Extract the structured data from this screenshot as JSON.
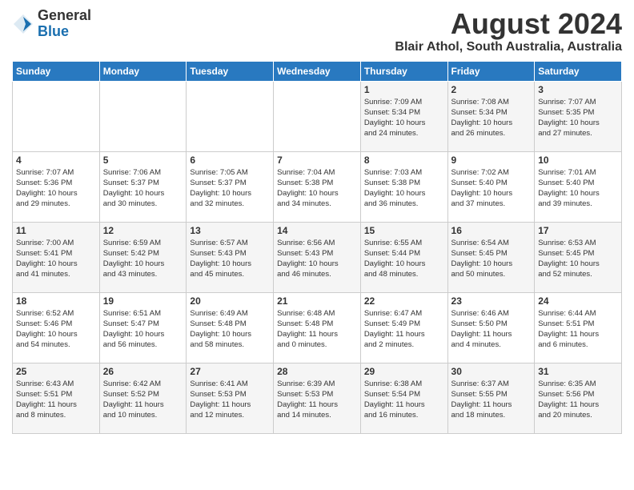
{
  "header": {
    "logo_general": "General",
    "logo_blue": "Blue",
    "month_year": "August 2024",
    "location": "Blair Athol, South Australia, Australia"
  },
  "days_of_week": [
    "Sunday",
    "Monday",
    "Tuesday",
    "Wednesday",
    "Thursday",
    "Friday",
    "Saturday"
  ],
  "weeks": [
    [
      {
        "day": "",
        "content": ""
      },
      {
        "day": "",
        "content": ""
      },
      {
        "day": "",
        "content": ""
      },
      {
        "day": "",
        "content": ""
      },
      {
        "day": "1",
        "content": "Sunrise: 7:09 AM\nSunset: 5:34 PM\nDaylight: 10 hours\nand 24 minutes."
      },
      {
        "day": "2",
        "content": "Sunrise: 7:08 AM\nSunset: 5:34 PM\nDaylight: 10 hours\nand 26 minutes."
      },
      {
        "day": "3",
        "content": "Sunrise: 7:07 AM\nSunset: 5:35 PM\nDaylight: 10 hours\nand 27 minutes."
      }
    ],
    [
      {
        "day": "4",
        "content": "Sunrise: 7:07 AM\nSunset: 5:36 PM\nDaylight: 10 hours\nand 29 minutes."
      },
      {
        "day": "5",
        "content": "Sunrise: 7:06 AM\nSunset: 5:37 PM\nDaylight: 10 hours\nand 30 minutes."
      },
      {
        "day": "6",
        "content": "Sunrise: 7:05 AM\nSunset: 5:37 PM\nDaylight: 10 hours\nand 32 minutes."
      },
      {
        "day": "7",
        "content": "Sunrise: 7:04 AM\nSunset: 5:38 PM\nDaylight: 10 hours\nand 34 minutes."
      },
      {
        "day": "8",
        "content": "Sunrise: 7:03 AM\nSunset: 5:38 PM\nDaylight: 10 hours\nand 36 minutes."
      },
      {
        "day": "9",
        "content": "Sunrise: 7:02 AM\nSunset: 5:40 PM\nDaylight: 10 hours\nand 37 minutes."
      },
      {
        "day": "10",
        "content": "Sunrise: 7:01 AM\nSunset: 5:40 PM\nDaylight: 10 hours\nand 39 minutes."
      }
    ],
    [
      {
        "day": "11",
        "content": "Sunrise: 7:00 AM\nSunset: 5:41 PM\nDaylight: 10 hours\nand 41 minutes."
      },
      {
        "day": "12",
        "content": "Sunrise: 6:59 AM\nSunset: 5:42 PM\nDaylight: 10 hours\nand 43 minutes."
      },
      {
        "day": "13",
        "content": "Sunrise: 6:57 AM\nSunset: 5:43 PM\nDaylight: 10 hours\nand 45 minutes."
      },
      {
        "day": "14",
        "content": "Sunrise: 6:56 AM\nSunset: 5:43 PM\nDaylight: 10 hours\nand 46 minutes."
      },
      {
        "day": "15",
        "content": "Sunrise: 6:55 AM\nSunset: 5:44 PM\nDaylight: 10 hours\nand 48 minutes."
      },
      {
        "day": "16",
        "content": "Sunrise: 6:54 AM\nSunset: 5:45 PM\nDaylight: 10 hours\nand 50 minutes."
      },
      {
        "day": "17",
        "content": "Sunrise: 6:53 AM\nSunset: 5:45 PM\nDaylight: 10 hours\nand 52 minutes."
      }
    ],
    [
      {
        "day": "18",
        "content": "Sunrise: 6:52 AM\nSunset: 5:46 PM\nDaylight: 10 hours\nand 54 minutes."
      },
      {
        "day": "19",
        "content": "Sunrise: 6:51 AM\nSunset: 5:47 PM\nDaylight: 10 hours\nand 56 minutes."
      },
      {
        "day": "20",
        "content": "Sunrise: 6:49 AM\nSunset: 5:48 PM\nDaylight: 10 hours\nand 58 minutes."
      },
      {
        "day": "21",
        "content": "Sunrise: 6:48 AM\nSunset: 5:48 PM\nDaylight: 11 hours\nand 0 minutes."
      },
      {
        "day": "22",
        "content": "Sunrise: 6:47 AM\nSunset: 5:49 PM\nDaylight: 11 hours\nand 2 minutes."
      },
      {
        "day": "23",
        "content": "Sunrise: 6:46 AM\nSunset: 5:50 PM\nDaylight: 11 hours\nand 4 minutes."
      },
      {
        "day": "24",
        "content": "Sunrise: 6:44 AM\nSunset: 5:51 PM\nDaylight: 11 hours\nand 6 minutes."
      }
    ],
    [
      {
        "day": "25",
        "content": "Sunrise: 6:43 AM\nSunset: 5:51 PM\nDaylight: 11 hours\nand 8 minutes."
      },
      {
        "day": "26",
        "content": "Sunrise: 6:42 AM\nSunset: 5:52 PM\nDaylight: 11 hours\nand 10 minutes."
      },
      {
        "day": "27",
        "content": "Sunrise: 6:41 AM\nSunset: 5:53 PM\nDaylight: 11 hours\nand 12 minutes."
      },
      {
        "day": "28",
        "content": "Sunrise: 6:39 AM\nSunset: 5:53 PM\nDaylight: 11 hours\nand 14 minutes."
      },
      {
        "day": "29",
        "content": "Sunrise: 6:38 AM\nSunset: 5:54 PM\nDaylight: 11 hours\nand 16 minutes."
      },
      {
        "day": "30",
        "content": "Sunrise: 6:37 AM\nSunset: 5:55 PM\nDaylight: 11 hours\nand 18 minutes."
      },
      {
        "day": "31",
        "content": "Sunrise: 6:35 AM\nSunset: 5:56 PM\nDaylight: 11 hours\nand 20 minutes."
      }
    ]
  ]
}
